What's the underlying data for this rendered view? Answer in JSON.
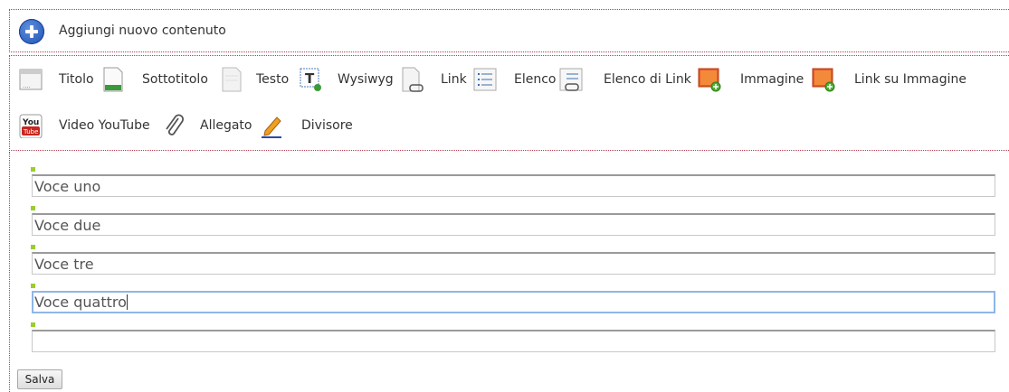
{
  "header": {
    "add_label": "Aggiungi nuovo contenuto"
  },
  "toolbar": {
    "items": [
      {
        "label": "Titolo",
        "icon": "title-icon"
      },
      {
        "label": "Sottotitolo",
        "icon": "subtitle-icon"
      },
      {
        "label": "Testo",
        "icon": "text-icon"
      },
      {
        "label": "Wysiwyg",
        "icon": "wysiwyg-icon"
      },
      {
        "label": "Link",
        "icon": "link-icon"
      },
      {
        "label": "Elenco",
        "icon": "list-icon"
      },
      {
        "label": "Elenco di Link",
        "icon": "link-list-icon"
      },
      {
        "label": "Immagine",
        "icon": "image-icon"
      },
      {
        "label": "Link su Immagine",
        "icon": "image-link-icon"
      },
      {
        "label": "Video YouTube",
        "icon": "youtube-icon"
      },
      {
        "label": "Allegato",
        "icon": "paperclip-icon"
      },
      {
        "label": "Divisore",
        "icon": "pencil-icon"
      }
    ]
  },
  "list": {
    "items": [
      {
        "value": "Voce uno"
      },
      {
        "value": "Voce due"
      },
      {
        "value": "Voce tre"
      },
      {
        "value": "Voce quattro",
        "focused": true
      },
      {
        "value": ""
      }
    ]
  },
  "actions": {
    "save_label": "Salva"
  },
  "colors": {
    "accent": "#1d4fb0",
    "marker": "#9acd32",
    "border_dotted": "#b04050"
  }
}
